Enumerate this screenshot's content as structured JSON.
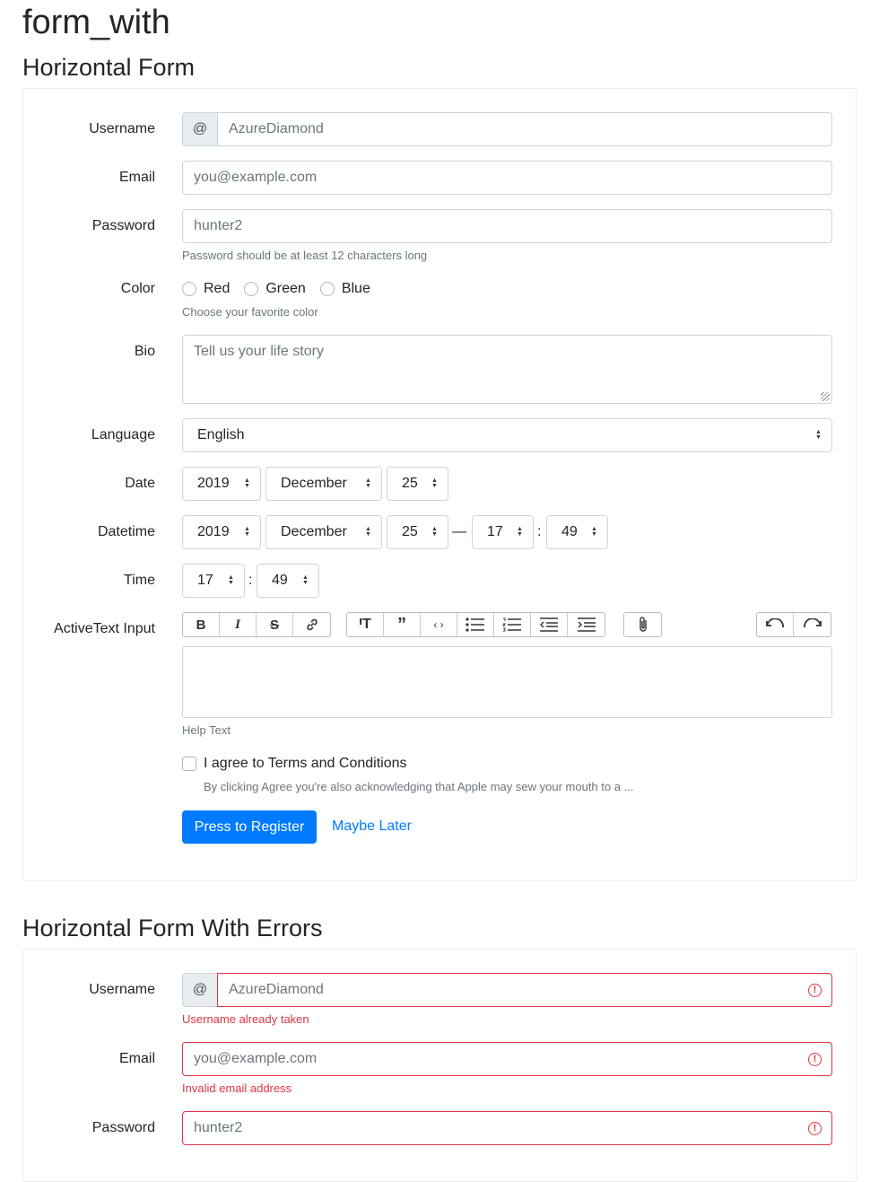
{
  "page": {
    "title": "form_with"
  },
  "horizontal_form": {
    "title": "Horizontal Form",
    "username": {
      "label": "Username",
      "prefix": "@",
      "value": "AzureDiamond"
    },
    "email": {
      "label": "Email",
      "value": "you@example.com"
    },
    "password": {
      "label": "Password",
      "value": "hunter2",
      "help": "Password should be at least 12 characters long"
    },
    "color": {
      "label": "Color",
      "options": [
        "Red",
        "Green",
        "Blue"
      ],
      "help": "Choose your favorite color"
    },
    "bio": {
      "label": "Bio",
      "placeholder": "Tell us your life story"
    },
    "language": {
      "label": "Language",
      "value": "English"
    },
    "date": {
      "label": "Date",
      "year": "2019",
      "month": "December",
      "day": "25"
    },
    "datetime": {
      "label": "Datetime",
      "year": "2019",
      "month": "December",
      "day": "25",
      "dash": "—",
      "hour": "17",
      "colon": ":",
      "minute": "49"
    },
    "time": {
      "label": "Time",
      "hour": "17",
      "colon": ":",
      "minute": "49"
    },
    "activetext": {
      "label": "ActiveText Input",
      "help": "Help Text",
      "toolbar": {
        "text_tools": [
          "bold-icon",
          "italic-icon",
          "strikethrough-icon",
          "link-icon"
        ],
        "block_tools": [
          "heading-icon",
          "quote-icon",
          "code-icon",
          "bullet-list-icon",
          "numbered-list-icon",
          "outdent-icon",
          "indent-icon"
        ],
        "file_tools": [
          "attach-icon"
        ],
        "history_tools": [
          "undo-icon",
          "redo-icon"
        ]
      }
    },
    "terms": {
      "label": "I agree to Terms and Conditions",
      "help": "By clicking Agree you're also acknowledging that Apple may sew your mouth to a ..."
    },
    "submit_label": "Press to Register",
    "cancel_label": "Maybe Later"
  },
  "horizontal_form_errors": {
    "title": "Horizontal Form With Errors",
    "username": {
      "label": "Username",
      "prefix": "@",
      "value": "AzureDiamond",
      "error": "Username already taken"
    },
    "email": {
      "label": "Email",
      "value": "you@example.com",
      "error": "Invalid email address"
    },
    "password": {
      "label": "Password",
      "value": "hunter2"
    }
  },
  "colors": {
    "primary": "#007bff",
    "danger": "#dc3545",
    "muted": "#6c757d",
    "border": "#ced4da"
  }
}
